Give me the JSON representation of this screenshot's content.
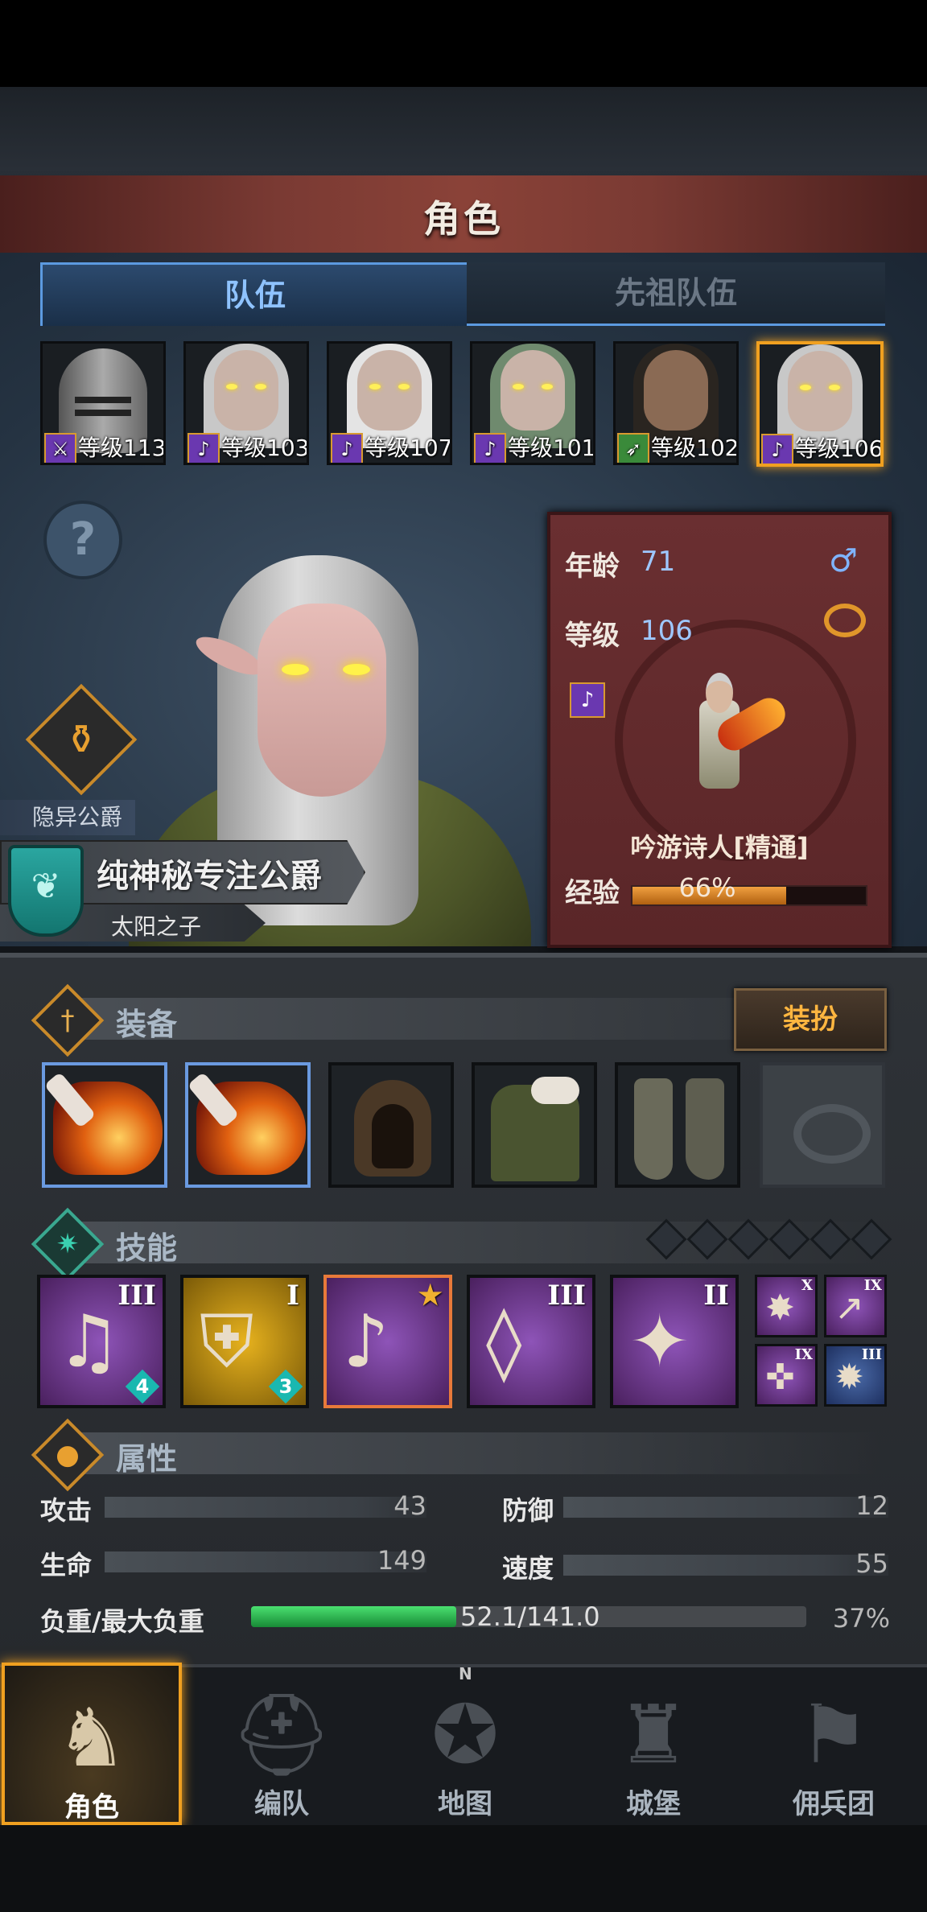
{
  "header": {
    "title": "角色"
  },
  "tabs": [
    {
      "label": "队伍"
    },
    {
      "label": "先祖队伍"
    }
  ],
  "party": [
    {
      "level_text": "等级113",
      "class_icon": "sword-icon"
    },
    {
      "level_text": "等级103",
      "class_icon": "lute-icon"
    },
    {
      "level_text": "等级107",
      "class_icon": "lute-icon"
    },
    {
      "level_text": "等级101",
      "class_icon": "lute-icon"
    },
    {
      "level_text": "等级102",
      "class_icon": "bow-icon"
    },
    {
      "level_text": "等级106",
      "class_icon": "lute-icon",
      "selected": true
    }
  ],
  "character": {
    "title_tag": "隐异公爵",
    "name": "纯神秘专注公爵",
    "subtitle": "太阳之子",
    "age_label": "年龄",
    "age": "71",
    "level_label": "等级",
    "level": "106",
    "class_name": "吟游诗人[精通]",
    "exp_label": "经验",
    "exp_text": "66%",
    "exp_fraction": 0.66
  },
  "equipment": {
    "header": "装备",
    "dress_button": "装扮",
    "slots": [
      "lute",
      "lute",
      "hood",
      "tunic",
      "boots",
      "ring-empty"
    ]
  },
  "skills": {
    "header": "技能",
    "items": [
      {
        "rank": "III",
        "badge": "4",
        "color": "purple"
      },
      {
        "rank": "I",
        "badge": "3",
        "color": "gold"
      },
      {
        "rank": "",
        "badge": "",
        "color": "purple",
        "selected": true
      },
      {
        "rank": "III",
        "badge": "",
        "color": "purple"
      },
      {
        "rank": "II",
        "badge": "",
        "color": "purple"
      }
    ],
    "small": [
      {
        "rank": "X",
        "color": "purple"
      },
      {
        "rank": "IX",
        "color": "purple"
      },
      {
        "rank": "IX",
        "color": "purple"
      },
      {
        "rank": "III",
        "color": "blue"
      }
    ]
  },
  "attributes": {
    "header": "属性",
    "attack_label": "攻击",
    "attack": "43",
    "defense_label": "防御",
    "defense": "12",
    "hp_label": "生命",
    "hp": "149",
    "speed_label": "速度",
    "speed": "55",
    "load_label": "负重/最大负重",
    "load_text": "52.1/141.0",
    "load_percent": "37%",
    "load_fraction": 0.37
  },
  "nav": [
    {
      "label": "角色",
      "active": true
    },
    {
      "label": "编队"
    },
    {
      "label": "地图"
    },
    {
      "label": "城堡"
    },
    {
      "label": "佣兵团"
    }
  ],
  "map_compass": "N",
  "colors": {
    "accent": "#f0a020",
    "tab_active": "#8fc3ff",
    "exp": "#f0a040",
    "load": "#30c050"
  }
}
